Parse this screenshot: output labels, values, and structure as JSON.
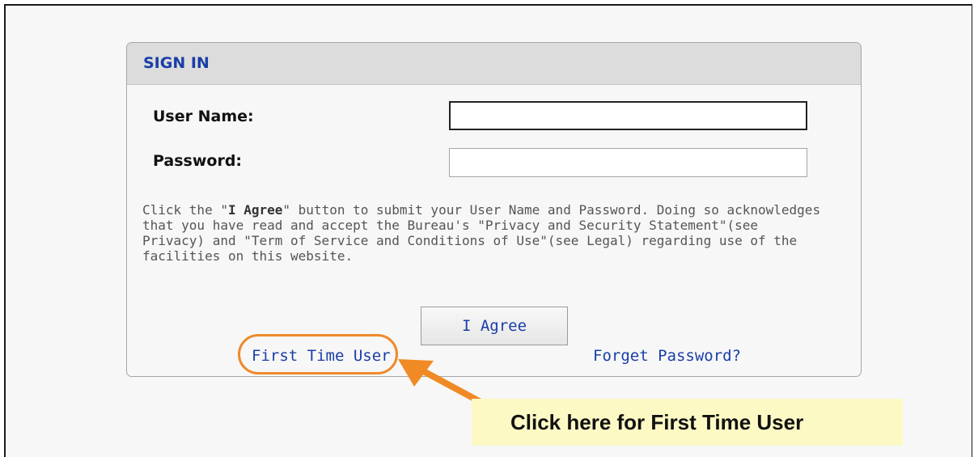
{
  "signin": {
    "title": "SIGN IN",
    "username_label": "User Name:",
    "username_value": "",
    "password_label": "Password:",
    "password_value": "",
    "notice": {
      "part1": "Click the \"",
      "bold": "I Agree",
      "part2": "\" button to submit your User Name and Password. Doing so acknowledges that you have read and accept the Bureau's \"Privacy and Security Statement\"(see Privacy) and \"Term of Service and Conditions of Use\"(see Legal) regarding use of the facilities on this website."
    },
    "agree_button": "I Agree",
    "first_time_link": "First Time User",
    "forgot_link": "Forget Password?"
  },
  "annotation": {
    "callout_text": "Click here for First Time User",
    "highlight_color": "#ee8a2b",
    "callout_bg": "#fcf9c4"
  },
  "colors": {
    "link": "#1a3ea8",
    "header_bg": "#dcdcdc"
  }
}
